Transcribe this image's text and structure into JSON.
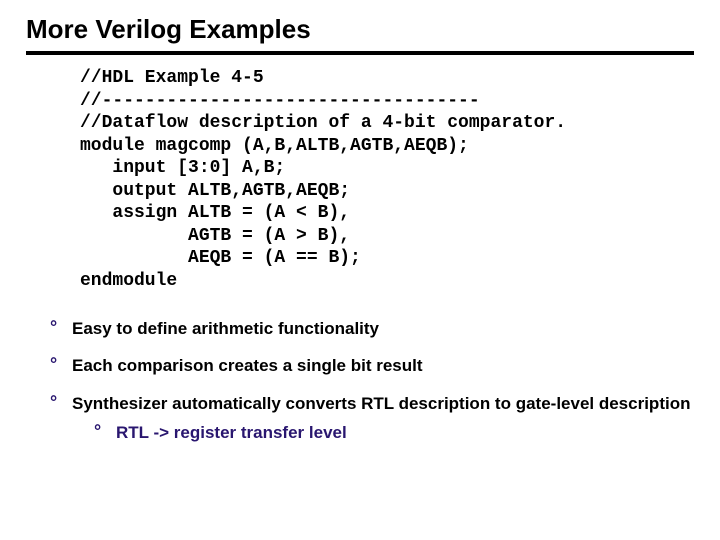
{
  "title": "More Verilog Examples",
  "code": {
    "l1": "//HDL Example 4-5",
    "l2": "//-----------------------------------",
    "l3": "//Dataflow description of a 4-bit comparator.",
    "l4": "module magcomp (A,B,ALTB,AGTB,AEQB);",
    "l5": "   input [3:0] A,B;",
    "l6": "   output ALTB,AGTB,AEQB;",
    "l7": "   assign ALTB = (A < B),",
    "l8": "          AGTB = (A > B),",
    "l9": "          AEQB = (A == B);",
    "l10": "endmodule"
  },
  "bullets": {
    "b1": "Easy to define arithmetic functionality",
    "b2": "Each comparison creates a single bit result",
    "b3a": "Synthesizer",
    "b3b": " automatically converts RTL description to gate-level description",
    "sub1": "RTL -> register transfer level"
  }
}
